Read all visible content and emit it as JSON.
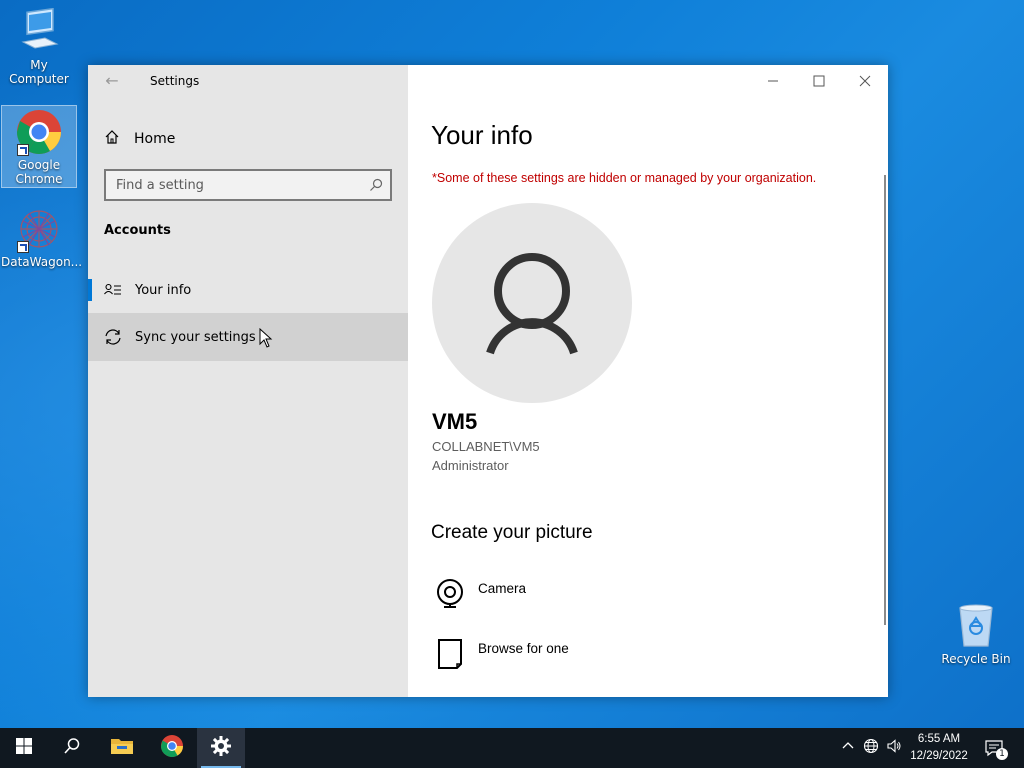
{
  "desktop": {
    "icons": [
      {
        "label": "My Computer"
      },
      {
        "label": "Google Chrome"
      },
      {
        "label": "DataWagon..."
      }
    ],
    "recycle_bin": {
      "label": "Recycle Bin"
    }
  },
  "window": {
    "title": "Settings",
    "sidebar": {
      "home_label": "Home",
      "search_placeholder": "Find a setting",
      "section_heading": "Accounts",
      "items": [
        {
          "label": "Your info",
          "active": true
        },
        {
          "label": "Sync your settings",
          "active": false
        }
      ]
    },
    "main": {
      "title": "Your info",
      "org_notice": "*Some of these settings are hidden or managed by your organization.",
      "user": {
        "name": "VM5",
        "account": "COLLABNET\\VM5",
        "role": "Administrator"
      },
      "create_picture": {
        "heading": "Create your picture",
        "options": [
          {
            "label": "Camera",
            "icon": "camera-icon"
          },
          {
            "label": "Browse for one",
            "icon": "document-icon"
          }
        ]
      }
    }
  },
  "taskbar": {
    "apps": [
      "start-icon",
      "search-icon",
      "file-explorer-icon",
      "chrome-icon",
      "settings-icon"
    ],
    "clock_time": "6:55 AM",
    "clock_date": "12/29/2022",
    "notification_count": "1"
  },
  "colors": {
    "accent": "#0078d7",
    "notice_red": "#c00000",
    "sidebar_bg": "#e6e6e6",
    "taskbar_bg": "#101820"
  }
}
